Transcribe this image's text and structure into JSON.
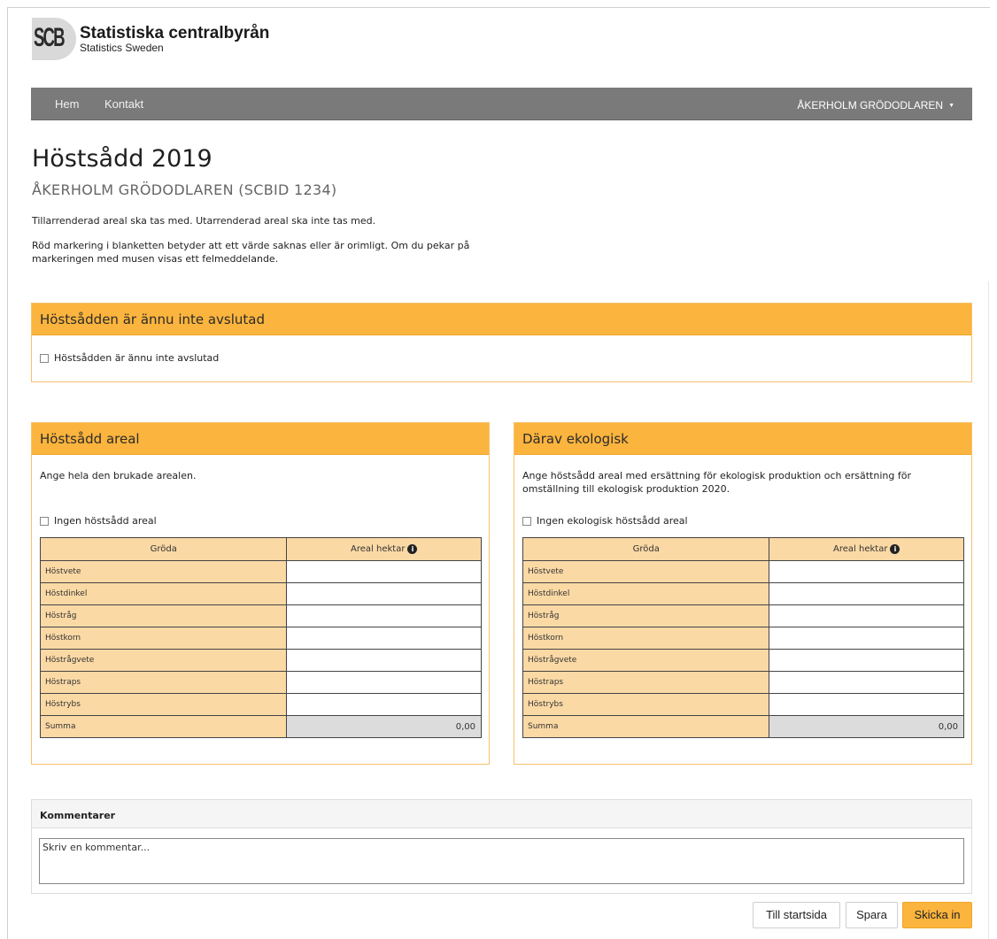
{
  "logo": {
    "mark": "SCB",
    "title": "Statistiska centralbyrån",
    "subtitle": "Statistics Sweden"
  },
  "nav": {
    "items": [
      "Hem",
      "Kontakt"
    ],
    "user": "ÅKERHOLM GRÖDODLAREN"
  },
  "page": {
    "title": "Höstsådd 2019",
    "subtitle": "ÅKERHOLM GRÖDODLAREN (SCBID 1234)",
    "info1": "Tillarrenderad areal ska tas med. Utarrenderad areal ska inte tas med.",
    "info2_line1": "Röd markering i blanketten betyder att ett värde saknas eller är orimligt. Om du pekar på",
    "info2_line2": "markeringen med musen visas ett felmeddelande."
  },
  "unfinished_panel": {
    "title": "Höstsådden är ännu inte avslutad",
    "checkbox_label": "Höstsådden är ännu inte avslutad"
  },
  "areal_panel": {
    "title": "Höstsådd areal",
    "desc": "Ange hela den brukade arealen.",
    "checkbox_label": "Ingen höstsådd areal",
    "col_crop": "Gröda",
    "col_area": "Areal hektar",
    "crops": [
      "Höstvete",
      "Höstdinkel",
      "Höstråg",
      "Höstkorn",
      "Höstrågvete",
      "Höstraps",
      "Höstrybs"
    ],
    "sum_label": "Summa",
    "sum_value": "0,00"
  },
  "eko_panel": {
    "title": "Därav ekologisk",
    "desc_line1": "Ange höstsådd areal med ersättning för ekologisk produktion och ersättning för",
    "desc_line2": "omställning till ekologisk produktion 2020.",
    "checkbox_label": "Ingen ekologisk höstsådd areal",
    "col_crop": "Gröda",
    "col_area": "Areal hektar",
    "crops": [
      "Höstvete",
      "Höstdinkel",
      "Höstråg",
      "Höstkorn",
      "Höstrågvete",
      "Höstraps",
      "Höstrybs"
    ],
    "sum_label": "Summa",
    "sum_value": "0,00"
  },
  "comments": {
    "title": "Kommentarer",
    "placeholder": "Skriv en kommentar..."
  },
  "buttons": {
    "start": "Till startsida",
    "save": "Spara",
    "submit": "Skicka in"
  },
  "colors": {
    "accent": "#fbb43d",
    "table_header": "#fbd9a5",
    "navbar": "#7a7a7a"
  }
}
